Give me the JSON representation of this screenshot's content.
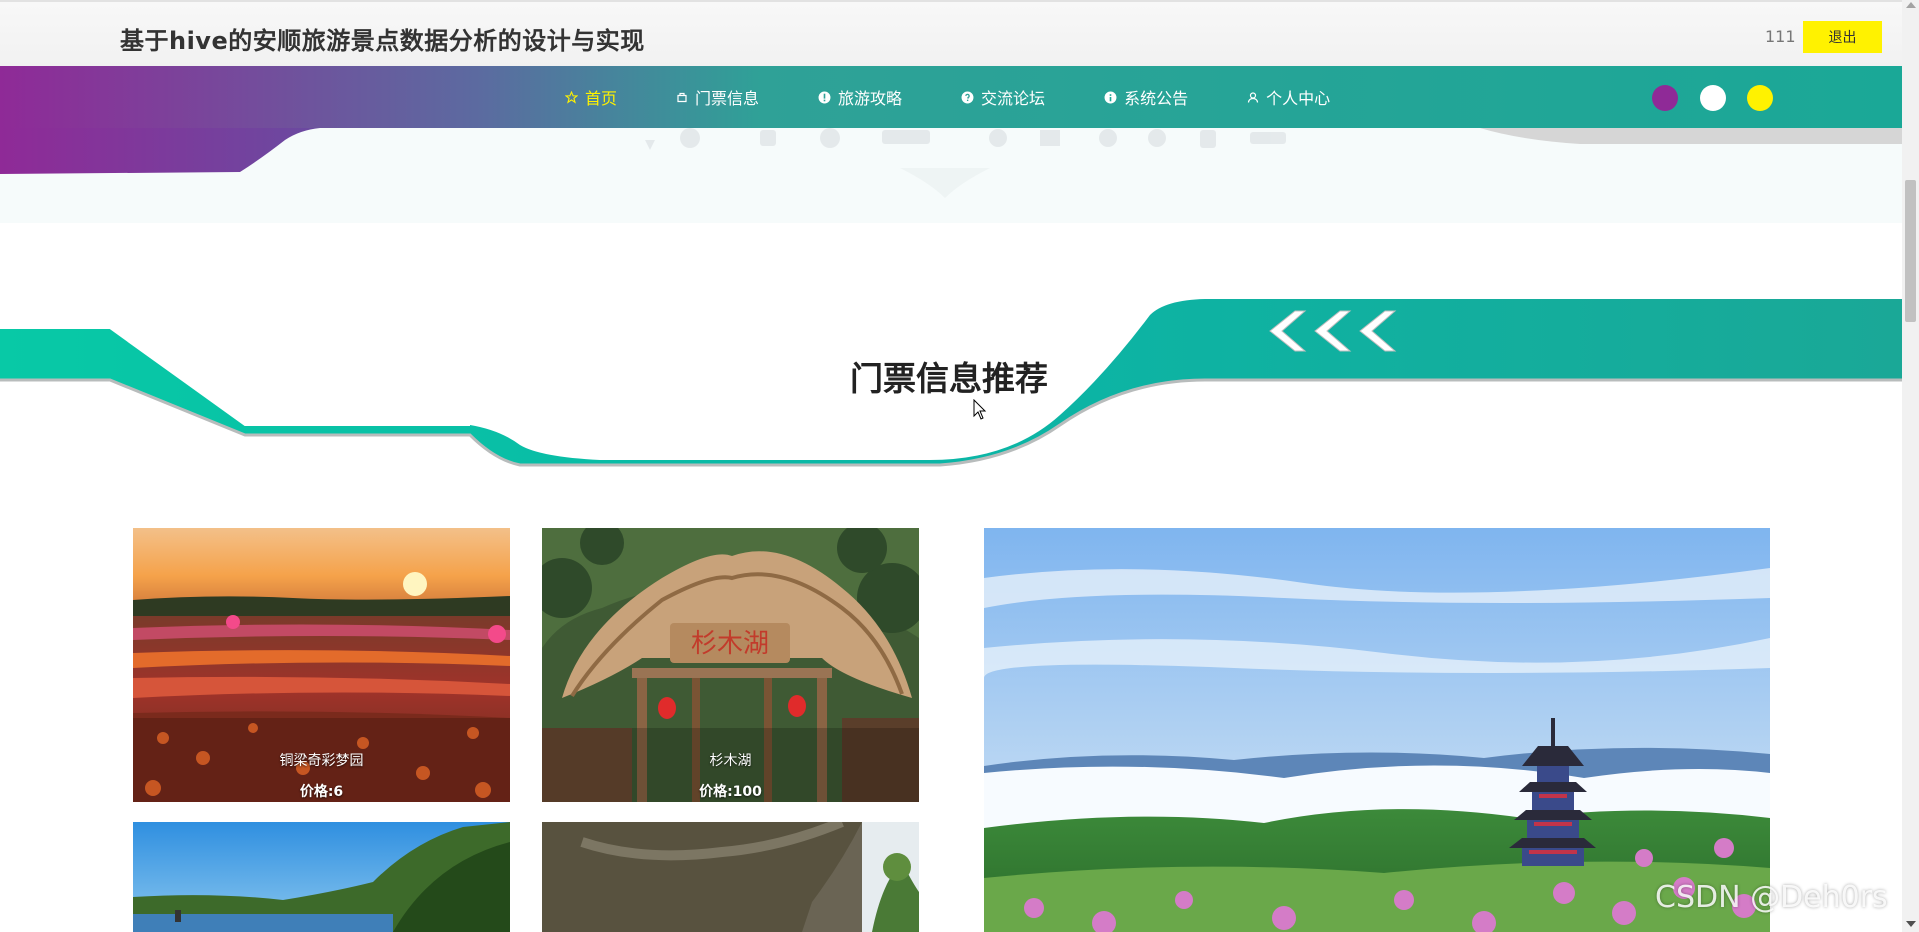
{
  "header": {
    "title": "基于hive的安顺旅游景点数据分析的设计与实现",
    "username": "111",
    "logout_label": "退出"
  },
  "nav": {
    "items": [
      {
        "label": "首页",
        "icon": "star-icon",
        "active": true
      },
      {
        "label": "门票信息",
        "icon": "ticket-icon",
        "active": false
      },
      {
        "label": "旅游攻略",
        "icon": "info-icon",
        "active": false
      },
      {
        "label": "交流论坛",
        "icon": "question-icon",
        "active": false
      },
      {
        "label": "系统公告",
        "icon": "notice-icon",
        "active": false
      },
      {
        "label": "个人中心",
        "icon": "user-icon",
        "active": false
      }
    ],
    "theme_swatches": [
      "#8f2a97",
      "#ffffff",
      "#fff200"
    ]
  },
  "section": {
    "title": "门票信息推荐"
  },
  "cards": [
    {
      "name": "铜梁奇彩梦园",
      "price": "价格:6"
    },
    {
      "name": "杉木湖",
      "price": "价格:100"
    },
    {
      "name": "",
      "price": ""
    },
    {
      "name": "",
      "price": ""
    }
  ],
  "featured": {
    "alt": "景点图片"
  },
  "watermark": "CSDN @Deh0rs",
  "colors": {
    "accent": "#fff200",
    "teal": "#1aa897",
    "purple": "#8f2a97"
  }
}
